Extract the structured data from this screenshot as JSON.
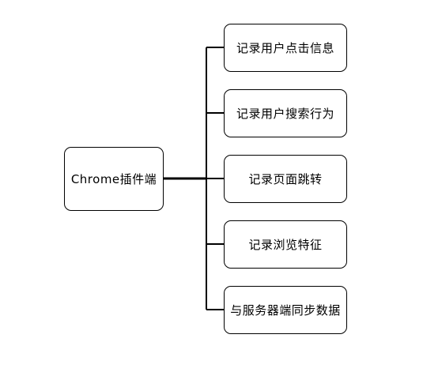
{
  "diagram": {
    "root": {
      "label": "Chrome插件端"
    },
    "children": [
      {
        "label": "记录用户点击信息"
      },
      {
        "label": "记录用户搜索行为"
      },
      {
        "label": "记录页面跳转"
      },
      {
        "label": "记录浏览特征"
      },
      {
        "label": "与服务器端同步数据"
      }
    ],
    "colors": {
      "line": "#000000",
      "box_border": "#000000",
      "box_fill": "#ffffff",
      "text": "#000000"
    }
  }
}
